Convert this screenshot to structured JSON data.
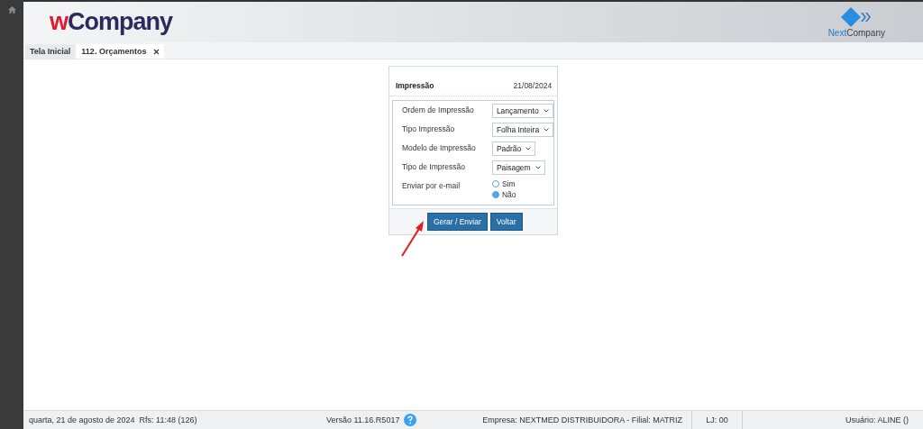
{
  "header": {
    "logo": {
      "prefix": "w",
      "name": "Company"
    },
    "brand": {
      "prefix": "Next",
      "name": "Company"
    }
  },
  "tabs": [
    {
      "label": "Tela Inicial",
      "selected": false,
      "closable": false
    },
    {
      "label": "112. Orçamentos",
      "selected": true,
      "closable": true
    }
  ],
  "dialog": {
    "title": "Impressão",
    "date": "21/08/2024",
    "fields": [
      {
        "kind": "select",
        "label": "Ordem de Impressão",
        "value": "Lançamento"
      },
      {
        "kind": "select",
        "label": "Tipo Impressão",
        "value": "Folha Inteira"
      },
      {
        "kind": "select",
        "label": "Modelo de Impressão",
        "value": "Padrão"
      },
      {
        "kind": "select",
        "label": "Tipo de Impressão",
        "value": "Paisagem"
      },
      {
        "kind": "radio",
        "label": "Enviar por e-mail",
        "options": [
          {
            "label": "Sim",
            "selected": false
          },
          {
            "label": "Não",
            "selected": true
          }
        ]
      }
    ],
    "buttons": [
      "Gerar / Enviar",
      "Voltar"
    ]
  },
  "status_bar": {
    "date": "quarta, 21 de agosto de 2024  Rfs: 11:48 (126)",
    "version": "Versão 11.16.R5017",
    "company": "Empresa: NEXTMED DISTRIBUIDORA - Filial: MATRIZ",
    "store": "LJ: 00",
    "user": "Usuário: ALINE ()"
  }
}
